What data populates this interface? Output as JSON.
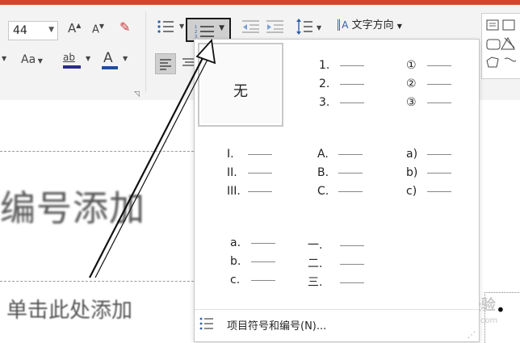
{
  "ribbon": {
    "font_size": "44",
    "font_grow_label": "A",
    "font_shrink_label": "A",
    "font_style_label": "Aa",
    "highlight_label": "ab",
    "font_color_label": "A",
    "text_direction": "文字方向"
  },
  "gallery": {
    "none_label": "无",
    "styles": [
      {
        "markers": [
          "1.",
          "2.",
          "3."
        ]
      },
      {
        "markers": [
          "①",
          "②",
          "③"
        ]
      },
      {
        "markers": [
          "I.",
          "II.",
          "III."
        ]
      },
      {
        "markers": [
          "A.",
          "B.",
          "C."
        ]
      },
      {
        "markers": [
          "a)",
          "b)",
          "c)"
        ]
      },
      {
        "markers": [
          "a.",
          "b.",
          "c."
        ]
      },
      {
        "markers": [
          "一.",
          "二.",
          "三."
        ]
      }
    ],
    "footer_label": "项目符号和编号(N)..."
  },
  "slide": {
    "title_placeholder": "编号添加",
    "subtitle_placeholder": "单击此处添加"
  },
  "watermark": {
    "logo": "Baidu经验",
    "url": "jingyan.baidu.com"
  },
  "colors": {
    "accent": "#d24726",
    "ribbon_bg": "#f3f3f3",
    "highlight": "#2b2b8f",
    "font_color_underline": "#1f4e9c"
  }
}
